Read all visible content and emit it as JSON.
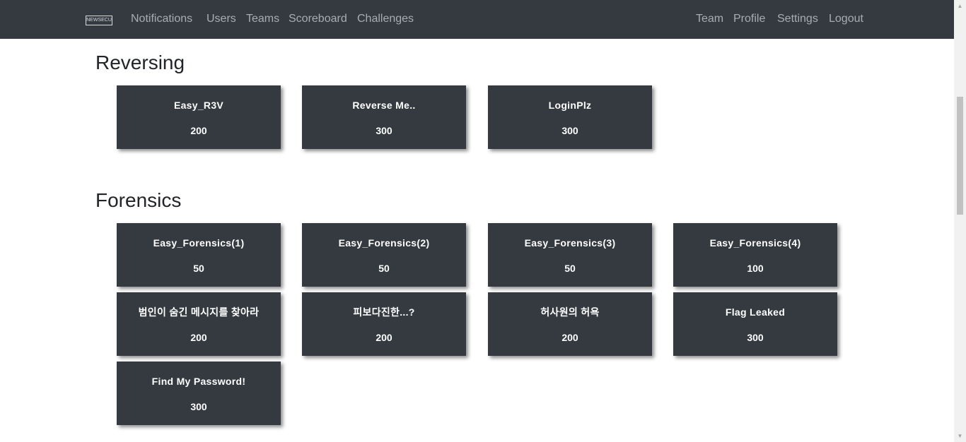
{
  "navbar": {
    "logo_text": "NEWSECU",
    "left_items": [
      "Notifications",
      "Users",
      "Teams",
      "Scoreboard",
      "Challenges"
    ],
    "right_items": [
      "Team",
      "Profile",
      "Settings",
      "Logout"
    ]
  },
  "sections": [
    {
      "title": "Reversing",
      "challenges": [
        {
          "name": "Easy_R3V",
          "points": "200"
        },
        {
          "name": "Reverse Me..",
          "points": "300"
        },
        {
          "name": "LoginPlz",
          "points": "300"
        }
      ]
    },
    {
      "title": "Forensics",
      "challenges": [
        {
          "name": "Easy_Forensics(1)",
          "points": "50"
        },
        {
          "name": "Easy_Forensics(2)",
          "points": "50"
        },
        {
          "name": "Easy_Forensics(3)",
          "points": "50"
        },
        {
          "name": "Easy_Forensics(4)",
          "points": "100"
        },
        {
          "name": "범인이 숨긴 메시지를 찾아라",
          "points": "200"
        },
        {
          "name": "피보다진한...?",
          "points": "200"
        },
        {
          "name": "허사원의 허욕",
          "points": "200"
        },
        {
          "name": "Flag Leaked",
          "points": "300"
        },
        {
          "name": "Find My Password!",
          "points": "300"
        }
      ]
    }
  ],
  "colors": {
    "navbar_bg": "#343a40",
    "card_bg": "#343a40",
    "nav_text": "#a7adb3",
    "card_text": "#ffffff"
  }
}
